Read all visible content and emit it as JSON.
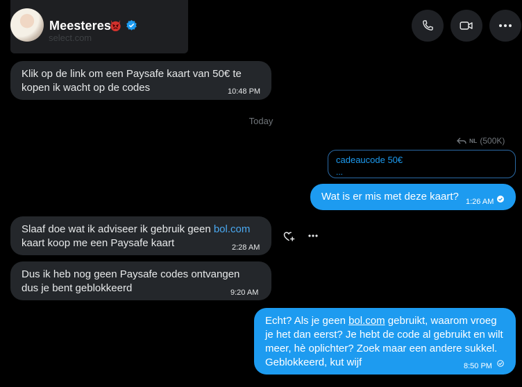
{
  "header": {
    "contact_name": "Meesteres",
    "previous_link_fragment": "select.com"
  },
  "messages": [
    {
      "id": "m1",
      "direction": "in",
      "text": "Klik op de link om een Paysafe kaart van 50€ te kopen ik wacht op de codes",
      "time": "10:48 PM"
    },
    {
      "id": "m2",
      "direction": "out",
      "text": "Wat is er mis met deze kaart?",
      "time": "1:26 AM",
      "status": "read"
    },
    {
      "id": "m3",
      "direction": "in",
      "text_before": "Slaaf doe wat ik adviseer ik gebruik geen ",
      "link": "bol.com",
      "text_after": "kaart koop me een Paysafe kaart",
      "time": "2:28 AM"
    },
    {
      "id": "m4",
      "direction": "in",
      "text": "Dus ik heb nog geen Paysafe codes ontvangen dus je bent geblokkeerd",
      "time": "9:20 AM"
    },
    {
      "id": "m5",
      "direction": "out",
      "text_before": "Echt? Als je geen ",
      "link": "bol.com",
      "text_after": " gebruikt, waarom vroeg je het dan eerst? Je hebt de code al gebruikt en wilt meer, hè oplichter? Zoek maar een andere sukkel. Geblokkeerd, kut wijf",
      "time": "8:50 PM",
      "status": "sent"
    }
  ],
  "divider": {
    "label": "Today"
  },
  "quoted_reply": {
    "lang": "NL",
    "size": "(500K)",
    "title": "cadeaucode 50€",
    "ellipsis": "..."
  },
  "colors": {
    "accent": "#1d9bf0",
    "incoming_bg": "#24272b",
    "background": "#000000"
  }
}
